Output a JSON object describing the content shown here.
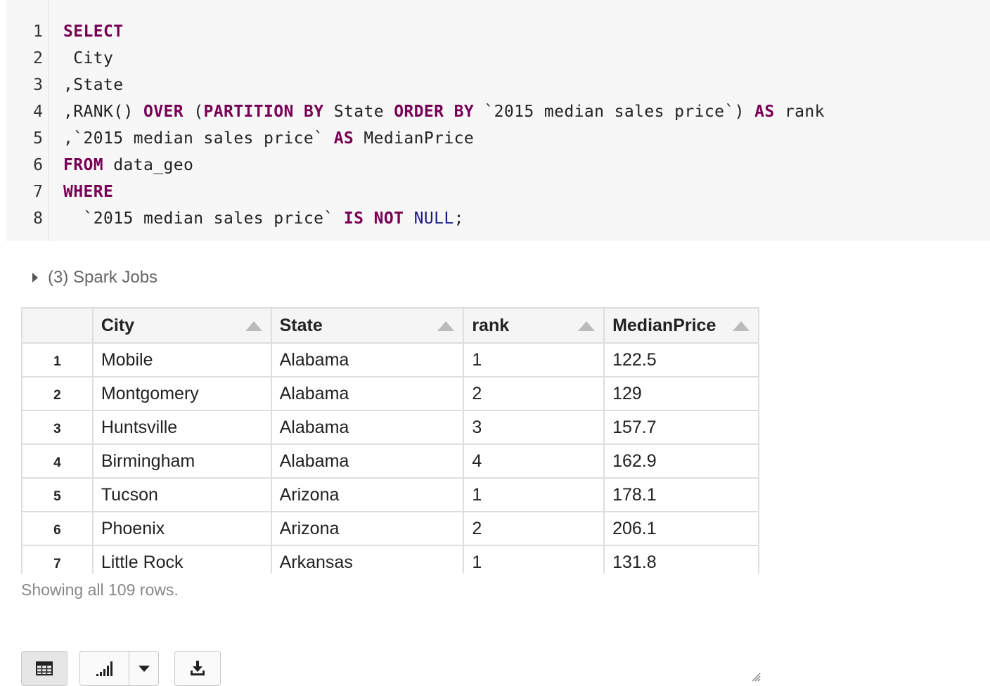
{
  "editor": {
    "line_numbers": [
      "1",
      "2",
      "3",
      "4",
      "5",
      "6",
      "7",
      "8"
    ],
    "lines": [
      [
        {
          "t": "SELECT",
          "c": "kw"
        }
      ],
      [
        {
          "t": " City",
          "c": ""
        }
      ],
      [
        {
          "t": ",State",
          "c": ""
        }
      ],
      [
        {
          "t": ",RANK() ",
          "c": ""
        },
        {
          "t": "OVER",
          "c": "kw"
        },
        {
          "t": " (",
          "c": ""
        },
        {
          "t": "PARTITION BY",
          "c": "kw"
        },
        {
          "t": " State ",
          "c": ""
        },
        {
          "t": "ORDER BY",
          "c": "kw"
        },
        {
          "t": " `2015 median sales price`) ",
          "c": ""
        },
        {
          "t": "AS",
          "c": "kw"
        },
        {
          "t": " rank",
          "c": ""
        }
      ],
      [
        {
          "t": ",`2015 median sales price` ",
          "c": ""
        },
        {
          "t": "AS",
          "c": "kw"
        },
        {
          "t": " MedianPrice",
          "c": ""
        }
      ],
      [
        {
          "t": "FROM",
          "c": "kw"
        },
        {
          "t": " data_geo",
          "c": ""
        }
      ],
      [
        {
          "t": "WHERE",
          "c": "kw"
        }
      ],
      [
        {
          "t": "  `2015 median sales price` ",
          "c": ""
        },
        {
          "t": "IS NOT",
          "c": "kw"
        },
        {
          "t": " ",
          "c": ""
        },
        {
          "t": "NULL",
          "c": "atom"
        },
        {
          "t": ";",
          "c": ""
        }
      ]
    ]
  },
  "spark_jobs": {
    "label": "(3) Spark Jobs"
  },
  "table": {
    "columns": [
      "City",
      "State",
      "rank",
      "MedianPrice"
    ],
    "rows": [
      [
        "1",
        "Mobile",
        "Alabama",
        "1",
        "122.5"
      ],
      [
        "2",
        "Montgomery",
        "Alabama",
        "2",
        "129"
      ],
      [
        "3",
        "Huntsville",
        "Alabama",
        "3",
        "157.7"
      ],
      [
        "4",
        "Birmingham",
        "Alabama",
        "4",
        "162.9"
      ],
      [
        "5",
        "Tucson",
        "Arizona",
        "1",
        "178.1"
      ],
      [
        "6",
        "Phoenix",
        "Arizona",
        "2",
        "206.1"
      ],
      [
        "7",
        "Little Rock",
        "Arkansas",
        "1",
        "131.8"
      ]
    ]
  },
  "footer": {
    "row_count_text": "Showing all 109 rows."
  },
  "toolbar": {
    "buttons": [
      "table-view-icon",
      "bar-chart-icon",
      "chevron-down-icon",
      "download-icon"
    ]
  },
  "colors": {
    "keyword": "#770055",
    "atom": "#1a1a8c",
    "editor_bg": "#f7f7f7",
    "muted_text": "#888888"
  }
}
